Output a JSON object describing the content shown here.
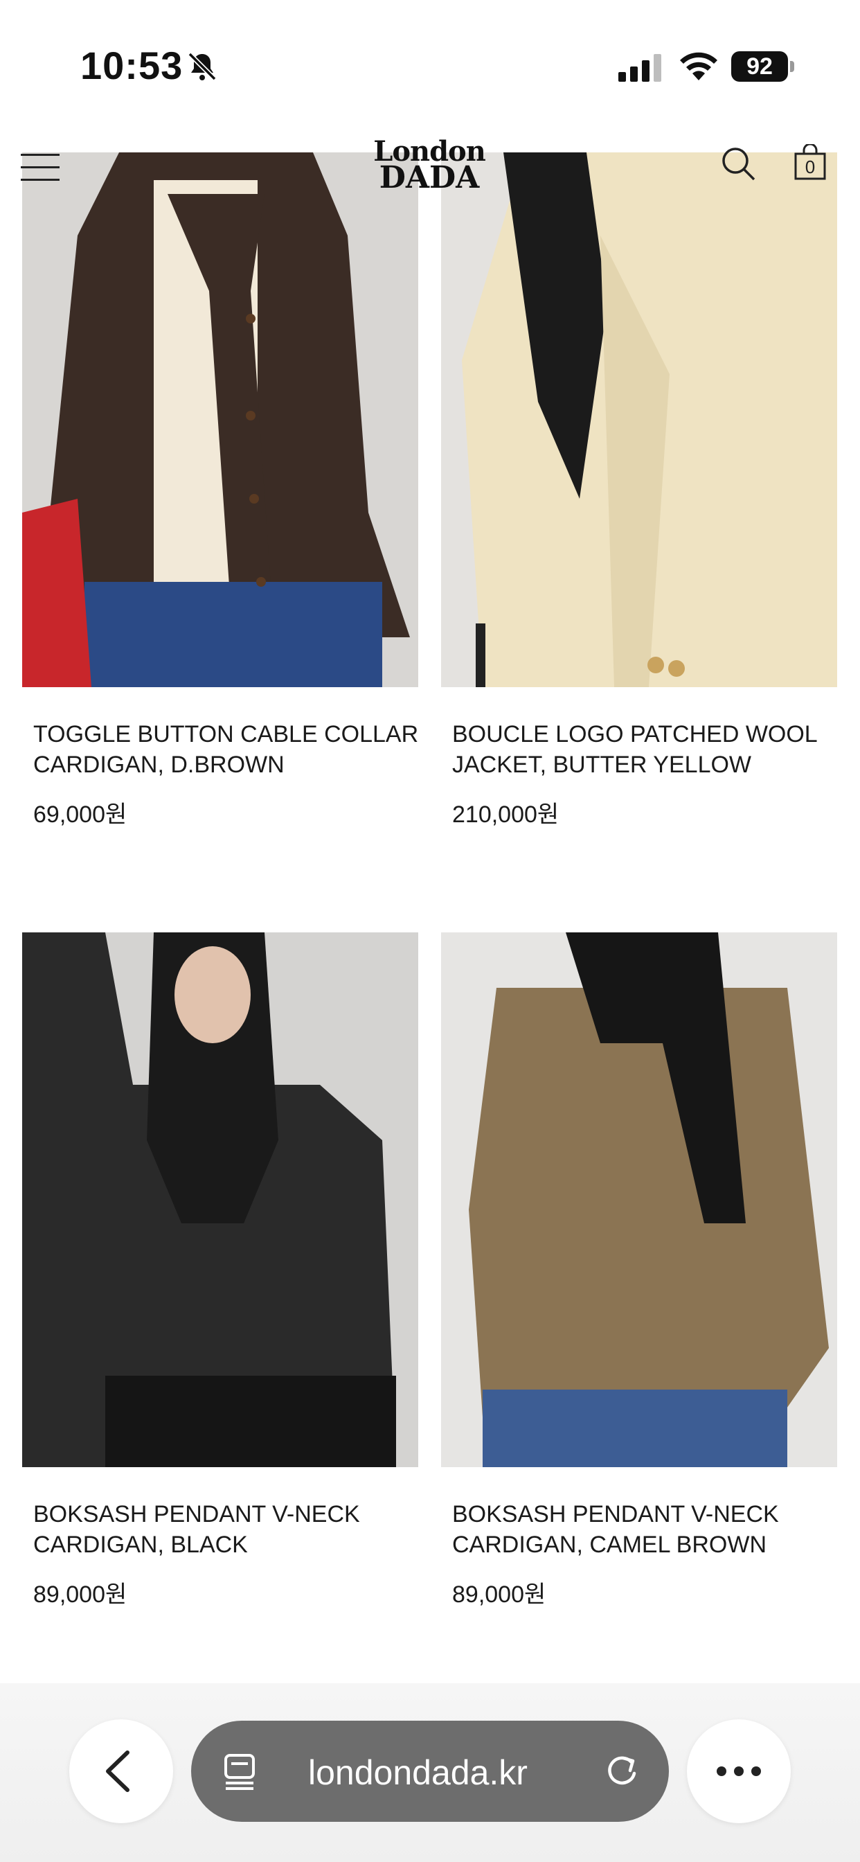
{
  "status_bar": {
    "time": "10:53",
    "battery": "92",
    "icons": [
      "bell-slash-icon",
      "cellular-signal-icon",
      "wifi-icon",
      "battery-icon"
    ]
  },
  "header": {
    "logo_line1": "London",
    "logo_line2": "DADA",
    "cart_count": "0",
    "icons": [
      "menu-icon",
      "search-icon",
      "shopping-bag-icon"
    ]
  },
  "products": [
    {
      "name": "TOGGLE BUTTON CABLE COLLAR CARDIGAN, D.BROWN",
      "price": "69,000원",
      "image_color": "#3a2b24"
    },
    {
      "name": "BOUCLE LOGO PATCHED WOOL JACKET, BUTTER YELLOW",
      "price": "210,000원",
      "image_color": "#efe3c4"
    },
    {
      "name": "BOKSASH PENDANT V-NECK CARDIGAN, BLACK",
      "price": "89,000원",
      "image_color": "#2b2b2b"
    },
    {
      "name": "BOKSASH PENDANT V-NECK CARDIGAN, CAMEL BROWN",
      "price": "89,000원",
      "image_color": "#8a7353"
    }
  ],
  "browser_bar": {
    "url": "londondada.kr",
    "icons": [
      "back-chevron-icon",
      "tabs-icon",
      "reload-icon",
      "more-dots-icon"
    ]
  }
}
